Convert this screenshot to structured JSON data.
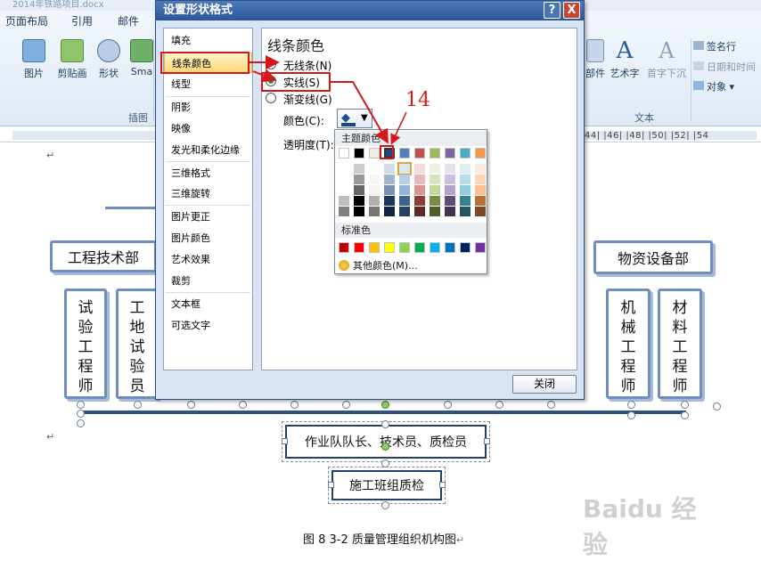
{
  "document": {
    "titlebar": "2014年铁路项目.docx",
    "caption": "图 8 3-2 质量管理组织机构图"
  },
  "ribbon": {
    "tabs": [
      "页面布局",
      "引用",
      "邮件"
    ],
    "buttons": [
      "图片",
      "剪贴画",
      "形状",
      "Sma",
      "部件",
      "艺术字",
      "首字下沉"
    ],
    "small_buttons": [
      "签名行",
      "日期和时间",
      "对象"
    ],
    "groups": [
      "插图",
      "文本"
    ],
    "ruler_numbers": "44| |46| |48| |50| |52| |54"
  },
  "orgchart": {
    "left_dept": "工程技术部",
    "right_dept": "物资设备部",
    "boxes": [
      "试验工程师",
      "工地试验员",
      "机械工程师",
      "材料工程师"
    ],
    "captain": "作业队队长、技术员、质检员",
    "team": "施工班组质检"
  },
  "dialog": {
    "title": "设置形状格式",
    "help": "?",
    "close_x": "X",
    "nav": [
      "填充",
      "线条颜色",
      "线型",
      "阴影",
      "映像",
      "发光和柔化边缘",
      "三维格式",
      "三维旋转",
      "图片更正",
      "图片颜色",
      "艺术效果",
      "裁剪",
      "文本框",
      "可选文字"
    ],
    "section_title": "线条颜色",
    "options": [
      "无线条(N)",
      "实线(S)",
      "渐变线(G)"
    ],
    "color_label": "颜色(C):",
    "transparency_label": "透明度(T):",
    "close_button": "关闭"
  },
  "color_popup": {
    "theme_title": "主题颜色",
    "standard_title": "标准色",
    "more_colors": "其他颜色(M)...",
    "theme_colors": [
      "#ffffff",
      "#000000",
      "#eeece1",
      "#1f497d",
      "#4f81bd",
      "#c0504d",
      "#9bbb59",
      "#8064a2",
      "#4bacc6",
      "#f79646"
    ],
    "standard_colors": [
      "#c00000",
      "#ff0000",
      "#ffc000",
      "#ffff00",
      "#92d050",
      "#00b050",
      "#00b0f0",
      "#0070c0",
      "#002060",
      "#7030a0"
    ]
  },
  "annotation": {
    "step": "14"
  }
}
